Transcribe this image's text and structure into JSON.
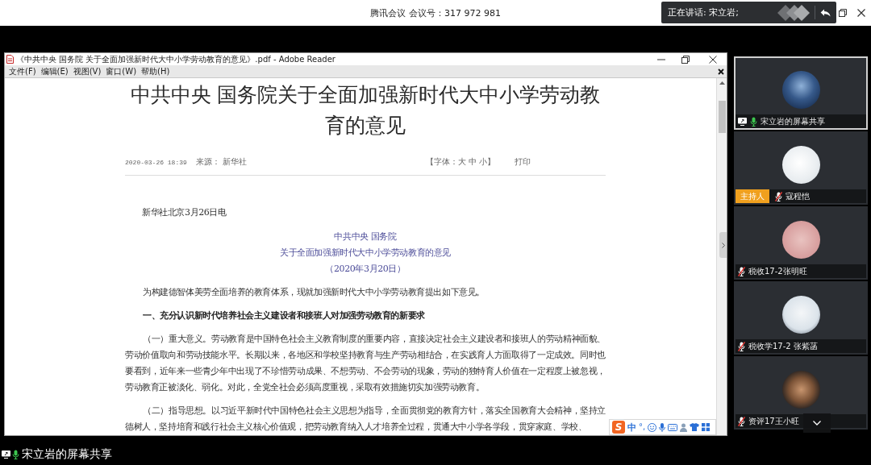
{
  "meeting_bar": {
    "app_name": "腾讯会议",
    "meeting_number": "会议号：317 972 981",
    "speaking_notice": "正在讲话: 宋立岩;"
  },
  "reader": {
    "title": "《中共中央 国务院 关于全面加强新时代大中小学劳动教育的意见》.pdf - Adobe Reader",
    "menu": [
      "文件(F)",
      "编辑(E)",
      "视图(V)",
      "窗口(W)",
      "帮助(H)"
    ],
    "document": {
      "title": "中共中央 国务院关于全面加强新时代大中小学劳动教育的意见",
      "meta": {
        "date": "2020-03-26 18:39",
        "source_label": "来源：",
        "source": "新华社",
        "font_size": "【字体：大 中 小】",
        "print": "打印"
      },
      "dateline": "新华社北京3月26日电",
      "heading_lines": [
        "中共中央 国务院",
        "关于全面加强新时代大中小学劳动教育的意见",
        "（2020年3月20日）"
      ],
      "paragraphs": [
        {
          "kind": "body",
          "text": "为构建德智体美劳全面培养的教育体系，现就加强新时代大中小学劳动教育提出如下意见。"
        },
        {
          "kind": "heading",
          "text": "一、充分认识新时代培养社会主义建设者和接班人对加强劳动教育的新要求"
        },
        {
          "kind": "body",
          "text": "（一）重大意义。劳动教育是中国特色社会主义教育制度的重要内容，直接决定社会主义建设者和接班人的劳动精神面貌、劳动价值取向和劳动技能水平。长期以来，各地区和学校坚持教育与生产劳动相结合，在实践育人方面取得了一定成效。同时也要看到，近年来一些青少年中出现了不珍惜劳动成果、不想劳动、不会劳动的现象，劳动的独特育人价值在一定程度上被忽视，劳动教育正被淡化、弱化。对此，全党全社会必须高度重视，采取有效措施切实加强劳动教育。"
        },
        {
          "kind": "body",
          "text": "（二）指导思想。以习近平新时代中国特色社会主义思想为指导，全面贯彻党的教育方针，落实全国教育大会精神，坚持立德树人，坚持培育和践行社会主义核心价值观，把劳动教育纳入人才培养全过程，贯通大中小学各学段，贯穿家庭、学校、"
        }
      ]
    }
  },
  "ime_toolbar": {
    "logo": "S",
    "mode": "中",
    "punctuation": "°,"
  },
  "participants": [
    {
      "name": "宋立岩的屏幕共享",
      "selected": true,
      "sharing": true,
      "muted": false
    },
    {
      "name": "寇程恺",
      "selected": false,
      "sharing": false,
      "muted": true,
      "host_badge": "主持人"
    },
    {
      "name": "税收17-2张明旺",
      "selected": false,
      "sharing": false,
      "muted": true
    },
    {
      "name": "税收学17-2 张紫菡",
      "selected": false,
      "sharing": false,
      "muted": true
    },
    {
      "name": "资评17王小旺",
      "selected": false,
      "sharing": false,
      "muted": true
    }
  ],
  "share_label": {
    "text": "宋立岩的屏幕共享",
    "muted": false
  }
}
